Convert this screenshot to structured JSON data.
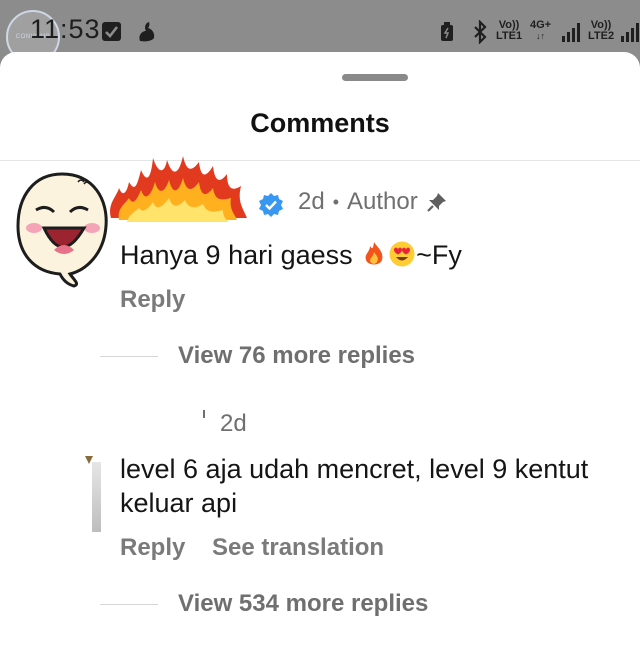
{
  "status_bar": {
    "time": "11:53",
    "watermark": "CONVOMB",
    "net1_top": "Vo))",
    "net1_bottom": "LTE1",
    "net_type": "4G+",
    "net2_top": "Vo))",
    "net2_bottom": "LTE2",
    "icons": [
      "check-box-icon",
      "bird-icon",
      "battery-icon",
      "bluetooth-icon",
      "signal-icon"
    ]
  },
  "sheet": {
    "title": "Comments"
  },
  "comments": [
    {
      "time": "2d",
      "separator": "•",
      "badge": "Author",
      "text_before": "Hanya 9 hari gaess ",
      "text_after": "~Fy",
      "reply_label": "Reply",
      "view_more": "View 76 more replies"
    },
    {
      "time": "2d",
      "text": "level 6 aja udah mencret, level 9 kentut keluar api",
      "reply_label": "Reply",
      "translate_label": "See translation",
      "view_more": "View 534 more replies"
    }
  ],
  "colors": {
    "sheet_bg": "#ffffff",
    "status_bg": "#8c8c8c",
    "muted_text": "#6f6f6f",
    "verified_blue": "#3897f0"
  }
}
